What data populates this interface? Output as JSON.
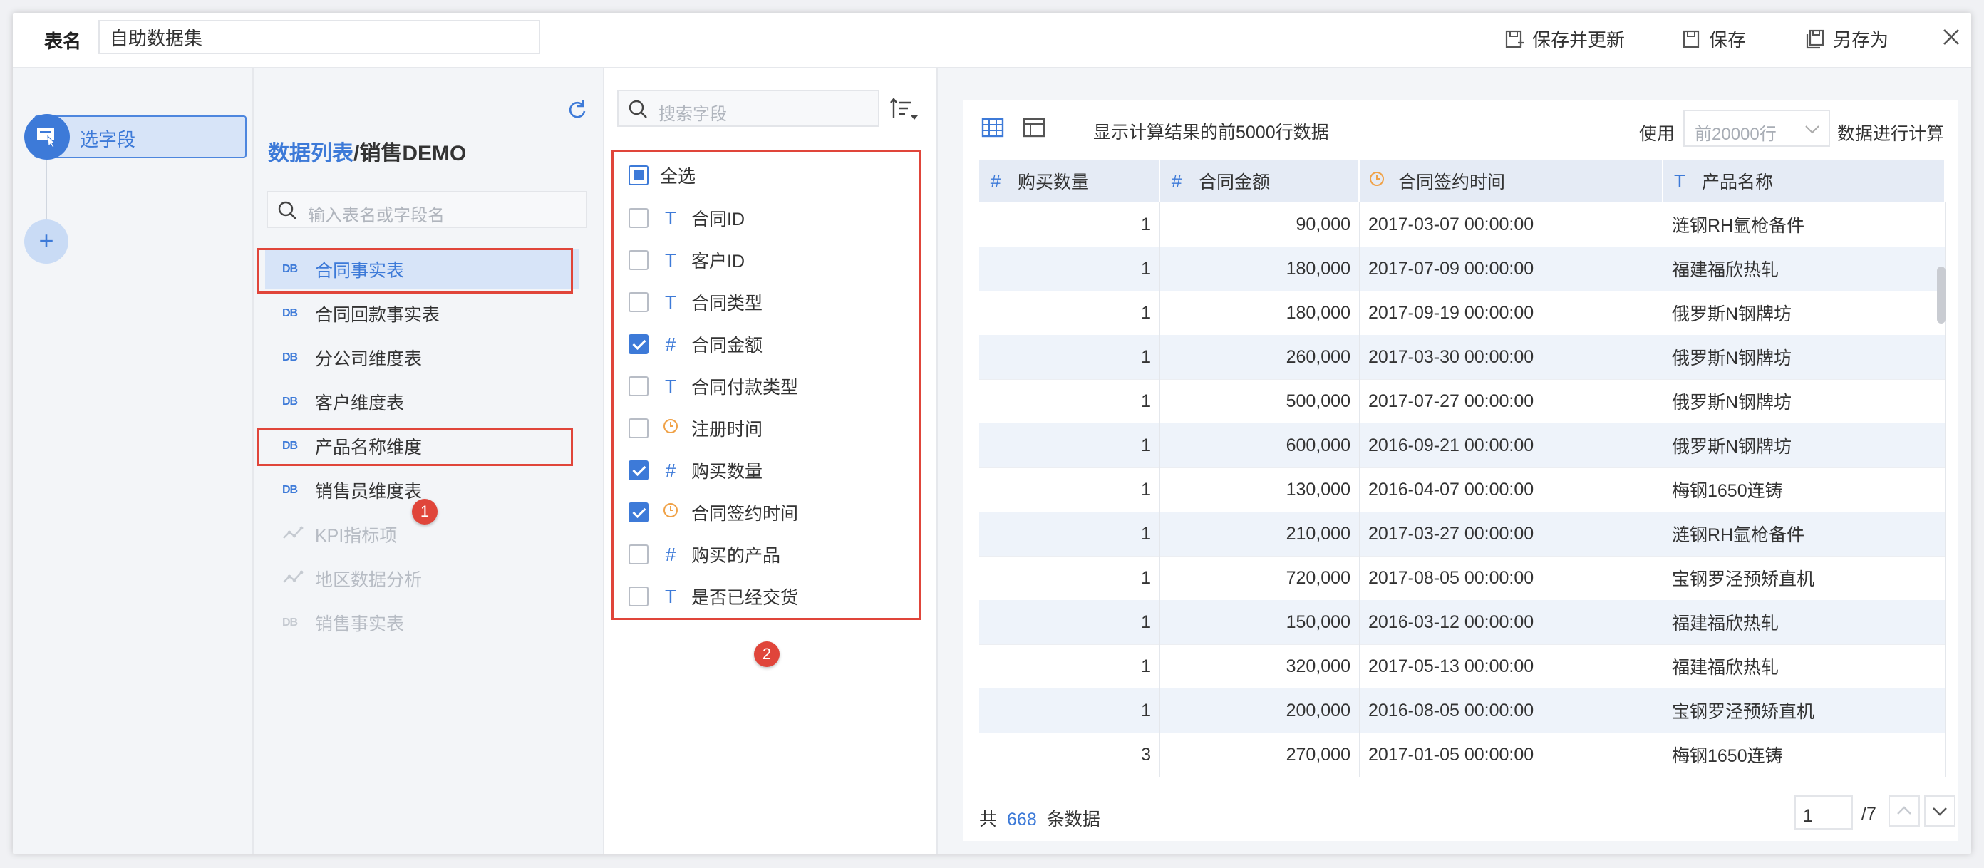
{
  "header": {
    "table_name_label": "表名",
    "table_name_value": "自助数据集",
    "save_update_label": "保存并更新",
    "save_label": "保存",
    "save_as_label": "另存为"
  },
  "steps": {
    "current_step": "选字段",
    "add_symbol": "+"
  },
  "table_list": {
    "breadcrumb_link": "数据列表",
    "breadcrumb_sep": "/",
    "breadcrumb_current": "销售DEMO",
    "search_placeholder": "输入表名或字段名",
    "items": [
      {
        "label": "合同事实表",
        "icon": "DB"
      },
      {
        "label": "合同回款事实表",
        "icon": "DB"
      },
      {
        "label": "分公司维度表",
        "icon": "DB"
      },
      {
        "label": "客户维度表",
        "icon": "DB"
      },
      {
        "label": "产品名称维度",
        "icon": "DB"
      },
      {
        "label": "销售员维度表",
        "icon": "DB"
      },
      {
        "label": "KPI指标项",
        "icon": "analysis"
      },
      {
        "label": "地区数据分析",
        "icon": "analysis"
      },
      {
        "label": "销售事实表",
        "icon": "DB"
      }
    ]
  },
  "annotations": {
    "badge1": "1",
    "badge2": "2"
  },
  "field_list": {
    "search_placeholder": "搜索字段",
    "select_all_label": "全选",
    "fields": [
      {
        "label": "合同ID",
        "type": "T",
        "checked": false
      },
      {
        "label": "客户ID",
        "type": "T",
        "checked": false
      },
      {
        "label": "合同类型",
        "type": "T",
        "checked": false
      },
      {
        "label": "合同金额",
        "type": "#",
        "checked": true
      },
      {
        "label": "合同付款类型",
        "type": "T",
        "checked": false
      },
      {
        "label": "注册时间",
        "type": "clock",
        "checked": false
      },
      {
        "label": "购买数量",
        "type": "#",
        "checked": true
      },
      {
        "label": "合同签约时间",
        "type": "clock",
        "checked": true
      },
      {
        "label": "购买的产品",
        "type": "#",
        "checked": false
      },
      {
        "label": "是否已经交货",
        "type": "T",
        "checked": false
      }
    ]
  },
  "preview": {
    "tip": "显示计算结果的前5000行数据",
    "use_label": "使用",
    "row_limit_value": "前20000行",
    "calc_label": "数据进行计算",
    "columns": [
      {
        "label": "购买数量",
        "type": "#"
      },
      {
        "label": "合同金额",
        "type": "#"
      },
      {
        "label": "合同签约时间",
        "type": "clock"
      },
      {
        "label": "产品名称",
        "type": "T"
      }
    ],
    "rows": [
      [
        "1",
        "90,000",
        "2017-03-07 00:00:00",
        "涟钢RH氩枪备件"
      ],
      [
        "1",
        "180,000",
        "2017-07-09 00:00:00",
        "福建福欣热轧"
      ],
      [
        "1",
        "180,000",
        "2017-09-19 00:00:00",
        "俄罗斯N钢牌坊"
      ],
      [
        "1",
        "260,000",
        "2017-03-30 00:00:00",
        "俄罗斯N钢牌坊"
      ],
      [
        "1",
        "500,000",
        "2017-07-27 00:00:00",
        "俄罗斯N钢牌坊"
      ],
      [
        "1",
        "600,000",
        "2016-09-21 00:00:00",
        "俄罗斯N钢牌坊"
      ],
      [
        "1",
        "130,000",
        "2016-04-07 00:00:00",
        "梅钢1650连铸"
      ],
      [
        "1",
        "210,000",
        "2017-03-27 00:00:00",
        "涟钢RH氩枪备件"
      ],
      [
        "1",
        "720,000",
        "2017-08-05 00:00:00",
        "宝钢罗泾预矫直机"
      ],
      [
        "1",
        "150,000",
        "2016-03-12 00:00:00",
        "福建福欣热轧"
      ],
      [
        "1",
        "320,000",
        "2017-05-13 00:00:00",
        "福建福欣热轧"
      ],
      [
        "1",
        "200,000",
        "2016-08-05 00:00:00",
        "宝钢罗泾预矫直机"
      ],
      [
        "3",
        "270,000",
        "2017-01-05 00:00:00",
        "梅钢1650连铸"
      ]
    ],
    "footer_prefix": "共",
    "total_count": "668",
    "footer_suffix": "条数据",
    "page_value": "1",
    "page_total": "/7"
  },
  "colors": {
    "accent": "#3d7ad8",
    "annotation_red": "#e0453a",
    "time_icon": "#f0a248"
  }
}
